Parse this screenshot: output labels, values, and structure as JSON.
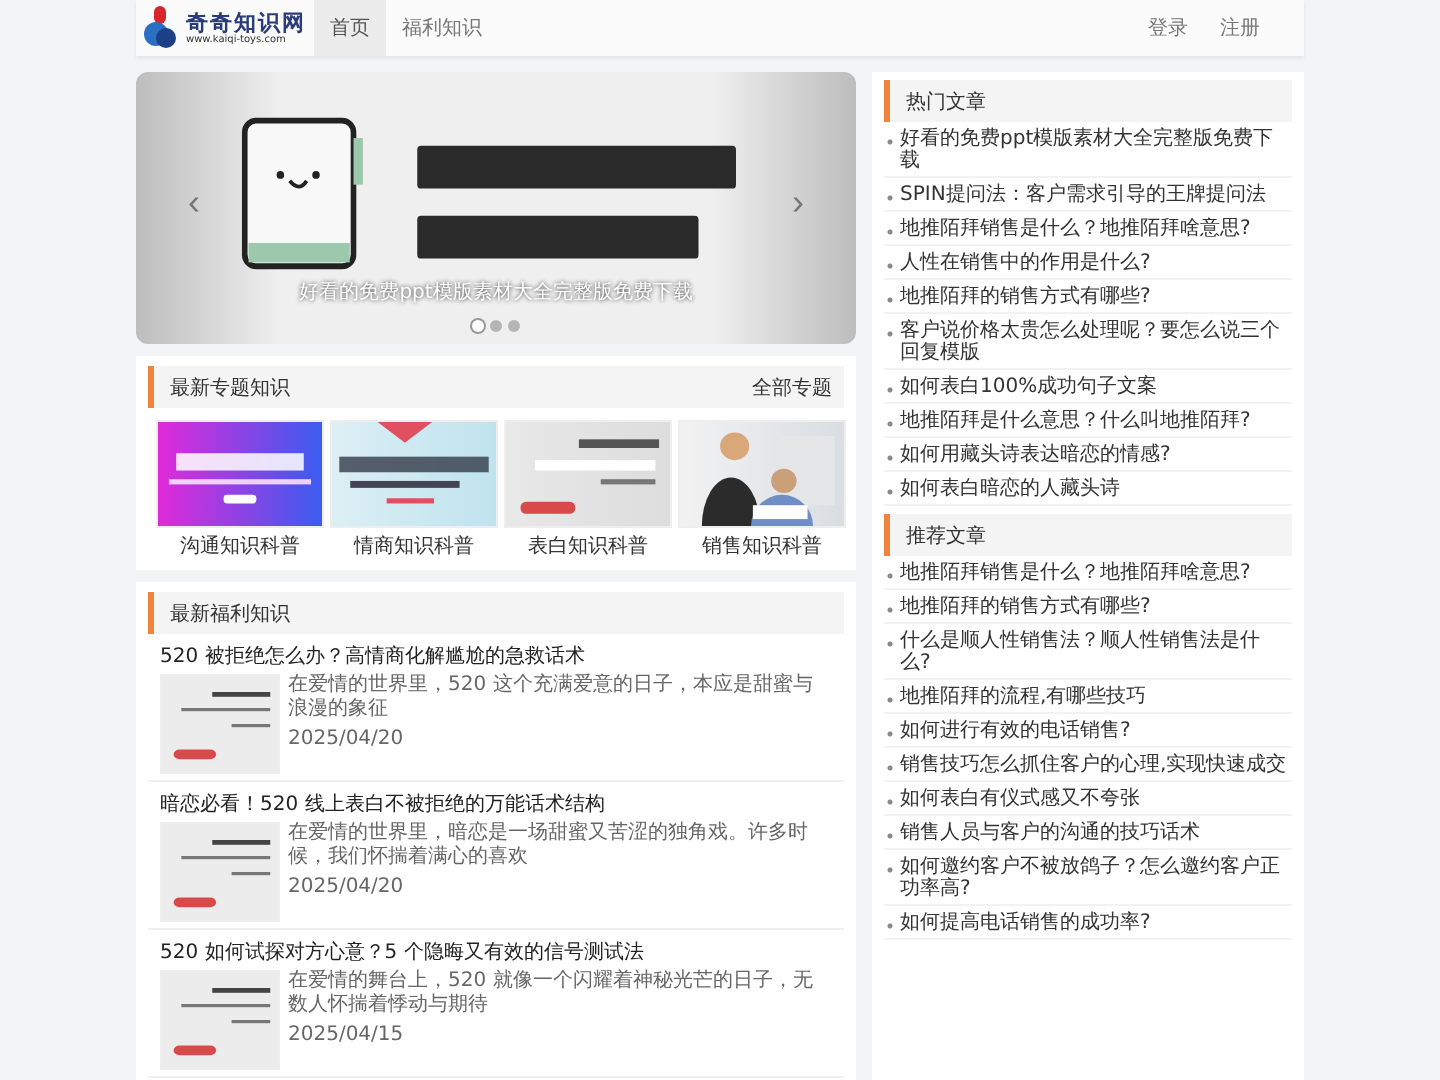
{
  "header": {
    "logo": {
      "name": "奇奇知识网",
      "url": "www.kaiqi-toys.com"
    },
    "nav": [
      {
        "label": "首页",
        "selected": true
      },
      {
        "label": "福利知识",
        "selected": false
      }
    ],
    "account": [
      "登录",
      "注册"
    ]
  },
  "carousel": {
    "kind": "picture",
    "caption": "好看的免费ppt模版素材大全完整版免费下载",
    "prev": "‹",
    "next": "›",
    "dots": [
      {
        "selected": true
      },
      {
        "selected": false
      },
      {
        "selected": false
      }
    ]
  },
  "topics": {
    "title": "最新专题知识",
    "more": "全部专题",
    "items": [
      {
        "label": "沟通知识科普",
        "kind": "picture"
      },
      {
        "label": "情商知识科普",
        "kind": "picture"
      },
      {
        "label": "表白知识科普",
        "kind": "picture"
      },
      {
        "label": "销售知识科普",
        "kind": "picture"
      }
    ]
  },
  "articles": {
    "title": "最新福利知识",
    "items": [
      {
        "title": "520 被拒绝怎么办？高情商化解尴尬的急救话术",
        "excerpt": "在爱情的世界里，520 这个充满爱意的日子，本应是甜蜜与浪漫的象征",
        "date": "2025/04/20"
      },
      {
        "title": "暗恋必看！520 线上表白不被拒绝的万能话术结构",
        "excerpt": "在爱情的世界里，暗恋是一场甜蜜又苦涩的独角戏。许多时候，我们怀揣着满心的喜欢",
        "date": "2025/04/20"
      },
      {
        "title": "520 如何试探对方心意？5 个隐晦又有效的信号测试法",
        "excerpt": "在爱情的舞台上，520 就像一个闪耀着神秘光芒的日子，无数人怀揣着悸动与期待",
        "date": "2025/04/15"
      }
    ]
  },
  "sidebar": [
    {
      "title": "热门文章",
      "items": [
        "好看的免费ppt模版素材大全完整版免费下载",
        "SPIN提问法：客户需求引导的王牌提问法",
        "地推陌拜销售是什么？地推陌拜啥意思?",
        "人性在销售中的作用是什么?",
        "地推陌拜的销售方式有哪些?",
        "客户说价格太贵怎么处理呢？要怎么说三个回复模版",
        "如何表白100%成功句子文案",
        "地推陌拜是什么意思？什么叫地推陌拜?",
        "如何用藏头诗表达暗恋的情感?",
        "如何表白暗恋的人藏头诗"
      ]
    },
    {
      "title": "推荐文章",
      "items": [
        "地推陌拜销售是什么？地推陌拜啥意思?",
        "地推陌拜的销售方式有哪些?",
        "什么是顺人性销售法？顺人性销售法是什么?",
        "地推陌拜的流程,有哪些技巧",
        "如何进行有效的电话销售?",
        "销售技巧怎么抓住客户的心理,实现快速成交",
        "如何表白有仪式感又不夸张",
        "销售人员与客户的沟通的技巧话术",
        "如何邀约客户不被放鸽子？怎么邀约客户正功率高?",
        "如何提高电话销售的成功率?"
      ]
    }
  ]
}
